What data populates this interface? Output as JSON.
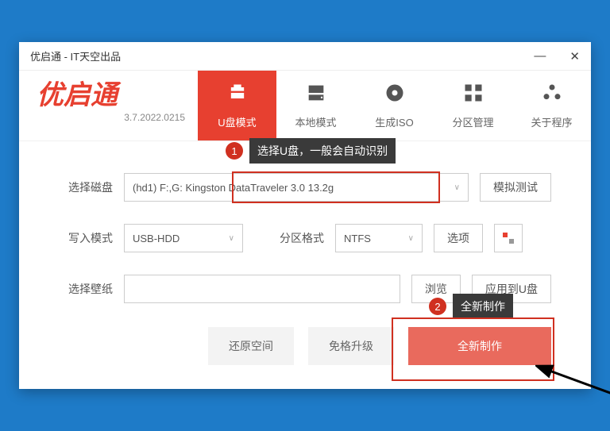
{
  "titlebar": {
    "title": "优启通 - IT天空出品"
  },
  "logo": {
    "text": "优启通",
    "version": "3.7.2022.0215"
  },
  "tabs": [
    {
      "label": "U盘模式"
    },
    {
      "label": "本地模式"
    },
    {
      "label": "生成ISO"
    },
    {
      "label": "分区管理"
    },
    {
      "label": "关于程序"
    }
  ],
  "disk": {
    "label": "选择磁盘",
    "value": "(hd1) F:,G: Kingston DataTraveler 3.0 13.2g",
    "test_btn": "模拟测试"
  },
  "write": {
    "label": "写入模式",
    "value": "USB-HDD",
    "fmt_label": "分区格式",
    "fmt_value": "NTFS",
    "options_btn": "选项"
  },
  "wallpaper": {
    "label": "选择壁纸",
    "browse_btn": "浏览",
    "apply_btn": "应用到U盘"
  },
  "bottom": {
    "restore_btn": "还原空间",
    "upgrade_btn": "免格升级",
    "create_btn": "全新制作"
  },
  "callouts": {
    "c1_num": "1",
    "c1_text": "选择U盘，一般会自动识别",
    "c2_num": "2",
    "c2_text": "全新制作"
  }
}
